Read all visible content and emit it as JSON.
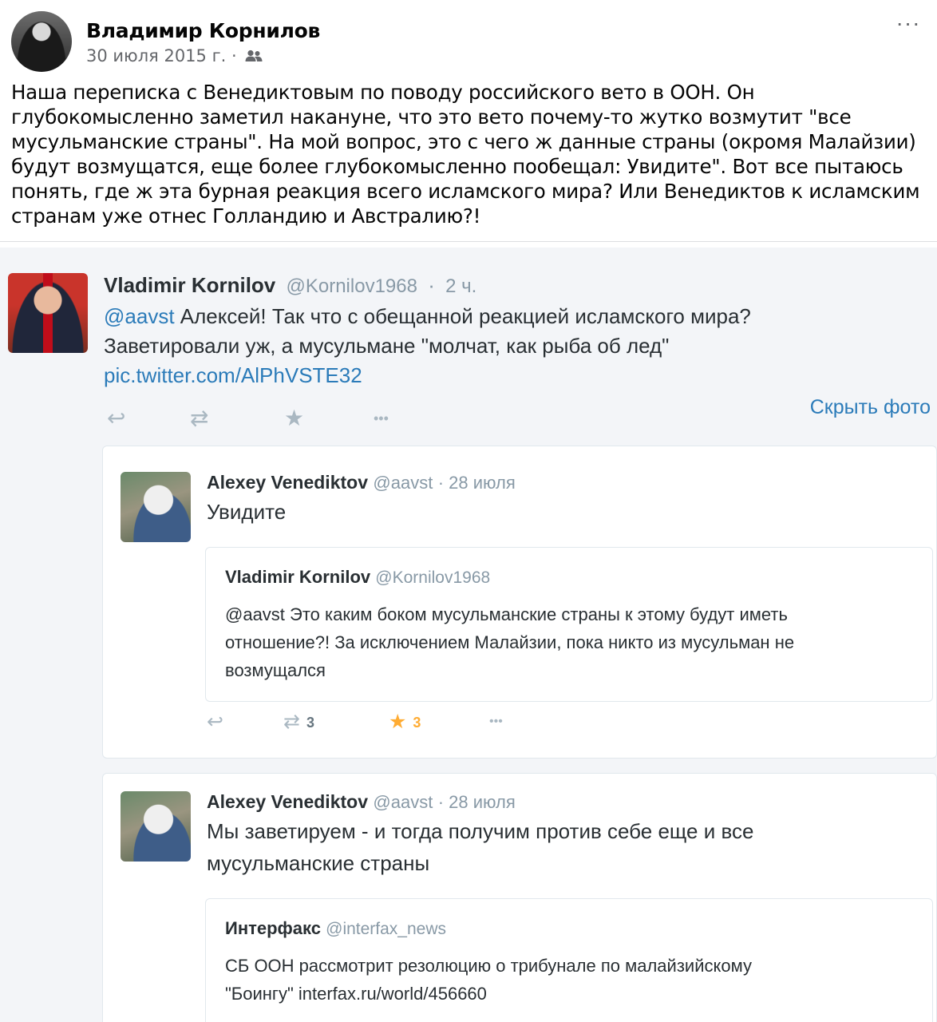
{
  "post": {
    "author": "Владимир Корнилов",
    "date": "30 июля 2015 г.",
    "separator": "·",
    "audience_icon": "people-icon",
    "more_label": "···",
    "text_lines": [
      "Наша переписка с Венедиктовым по поводу российского вето в ООН. Он",
      "глубокомысленно заметил накануне, что это вето почему-то жутко возмутит \"все",
      "мусульманские страны\". На мой вопрос, это с чего ж данные страны (окромя Малайзии)",
      "будут возмущатся, еще более глубокомысленно пообещал: Увидите\". Вот все пытаюсь",
      "понять, где ж эта бурная реакция всего исламского мира? Или Венедиктов к исламским",
      "странам уже отнес Голландию и Австралию?!"
    ]
  },
  "tweet": {
    "name": "Vladimir Kornilov",
    "handle": "@Kornilov1968",
    "time": "2 ч.",
    "mention": "@aavst",
    "line1_rest": " Алексей! Так что с обещанной реакцией исламского мира?",
    "line2": "Заветировали уж, а мусульмане \"молчат, как рыба об лед\"",
    "link": "pic.twitter.com/AlPhVSTE32",
    "hide_photo": "Скрыть фото",
    "actions": {
      "reply_icon": "↩",
      "retweet_icon": "⇄",
      "favorite_icon": "★",
      "more_icon": "•••"
    }
  },
  "replies": [
    {
      "name": "Alexey Venediktov",
      "handle": "@aavst",
      "time": "28 июля",
      "text_lines": [
        "Увидите"
      ],
      "quote": {
        "name": "Vladimir Kornilov",
        "handle": "@Kornilov1968",
        "text_lines": [
          "@aavst Это каким боком мусульманские страны к этому будут иметь",
          "отношение?! За исключением Малайзии, пока никто из мусульман не",
          "возмущался"
        ]
      },
      "retweets": "3",
      "favorites": "3"
    },
    {
      "name": "Alexey Venediktov",
      "handle": "@aavst",
      "time": "28 июля",
      "text_lines": [
        "Мы заветируем - и тогда получим против себе еще и все",
        "мусульманские страны"
      ],
      "quote": {
        "name": "Интерфакс",
        "handle": "@interfax_news",
        "text_lines": [
          "СБ ООН рассмотрит резолюцию о трибунале по малайзийскому",
          "\"Боингу\" interfax.ru/world/456660"
        ]
      }
    }
  ],
  "colors": {
    "link": "#2b7bb9",
    "muted": "#8899a6",
    "favorite": "#ffac33",
    "text": "#292f33"
  }
}
